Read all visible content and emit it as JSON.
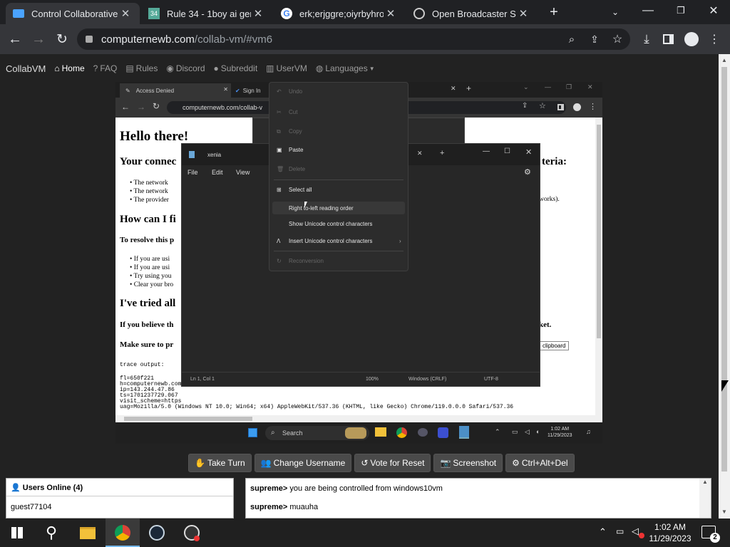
{
  "browser": {
    "tabs": [
      {
        "label": "Control Collaborative V",
        "icon": "monitor-icon"
      },
      {
        "label": "Rule 34 - 1boy ai gene",
        "icon": "rule34-favicon"
      },
      {
        "label": "erk;erjggre;oiyrbyhroe",
        "icon": "google-icon"
      },
      {
        "label": "Open Broadcaster Soft",
        "icon": "obs-icon"
      }
    ],
    "url_host": "computernewb.com",
    "url_path": "/collab-vm/#vm6"
  },
  "site": {
    "brand": "CollabVM",
    "nav": [
      "Home",
      "FAQ",
      "Rules",
      "Discord",
      "Subreddit",
      "UserVM",
      "Languages"
    ]
  },
  "vm": {
    "tabs": [
      "Access Denied",
      "Sign In"
    ],
    "url": "computernewb.com/collab-v",
    "h1": "Hello there!",
    "h2a": "Your connec",
    "h2a_tail": "teria:",
    "bullets1": [
      "The network",
      "The network",
      "The provider"
    ],
    "bullet_tail": "works).",
    "h2b": "How can I fi",
    "resolve": "To resolve this p",
    "bullets2": [
      "If you are usi",
      "If you are usi",
      "Try using you",
      "Clear your bro"
    ],
    "h2c": "I've tried all",
    "believe": "If you believe th",
    "believe_tail": "ket.",
    "makesure": "Make sure to pr",
    "clipboard": "clipboard",
    "trace_label": "trace output:",
    "trace": [
      "fl=650f221",
      "h=computernewb.com",
      "ip=143.244.47.86",
      "ts=1701237729.067",
      "visit_scheme=https",
      "uag=Mozilla/5.0 (Windows NT 10.0; Win64; x64) AppleWebKit/537.36 (KHTML, like Gecko) Chrome/119.0.0.0 Safari/537.36"
    ],
    "notepad": {
      "title": "xenia",
      "menu": [
        "File",
        "Edit",
        "View"
      ],
      "status": [
        "Ln 1, Col 1",
        "100%",
        "Windows (CRLF)",
        "UTF-8"
      ]
    },
    "context_menu": [
      {
        "label": "Undo",
        "enabled": false,
        "icon": "undo-icon"
      },
      {
        "label": "Cut",
        "enabled": false,
        "icon": "cut-icon"
      },
      {
        "label": "Copy",
        "enabled": false,
        "icon": "copy-icon"
      },
      {
        "label": "Paste",
        "enabled": true,
        "icon": "paste-icon"
      },
      {
        "label": "Delete",
        "enabled": false,
        "icon": "delete-icon"
      },
      {
        "label": "Select all",
        "enabled": true,
        "icon": "select-all-icon"
      },
      {
        "label": "Right to-left reading order",
        "enabled": true,
        "icon": ""
      },
      {
        "label": "Show Unicode control characters",
        "enabled": true,
        "icon": ""
      },
      {
        "label": "Insert Unicode control characters",
        "enabled": true,
        "icon": "omega-icon"
      },
      {
        "label": "Reconversion",
        "enabled": false,
        "icon": "reconversion-icon"
      }
    ],
    "taskbar": {
      "search": "Search",
      "time": "1:02 AM",
      "date": "11/29/2023"
    }
  },
  "controls": [
    "Take Turn",
    "Change Username",
    "Vote for Reset",
    "Screenshot",
    "Ctrl+Alt+Del"
  ],
  "users": {
    "header": "Users Online (4)",
    "list": [
      "guest77104"
    ]
  },
  "chat": [
    {
      "user": "supreme>",
      "msg": "you are being controlled from windows10vm"
    },
    {
      "user": "supreme>",
      "msg": "muauha"
    }
  ],
  "os_taskbar": {
    "time": "1:02 AM",
    "date": "11/29/2023",
    "notif": "2"
  }
}
